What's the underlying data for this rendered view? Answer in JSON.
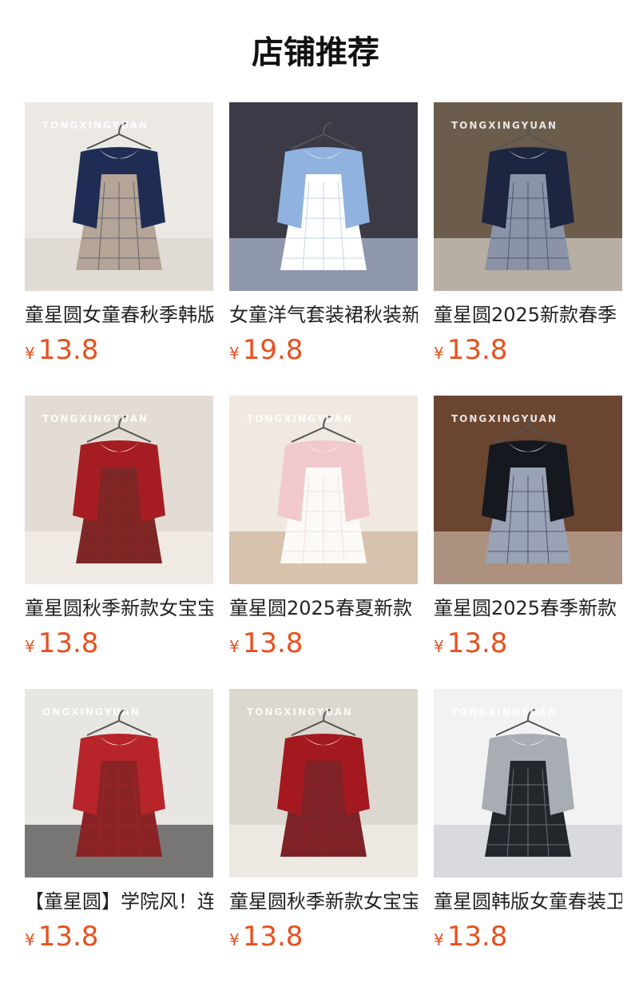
{
  "header": {
    "title": "店铺推荐"
  },
  "products": [
    {
      "name": "童星圆女童春秋季韩版",
      "currency": "¥",
      "price": "13.8",
      "watermark": "TONGXINGYUAN",
      "image": "girl-navy-cardigan-plaid-dress",
      "palette": [
        "#ece9e4",
        "#1f2d55",
        "#b5a596",
        "#d9d3cc"
      ]
    },
    {
      "name": "女童洋气套装裙秋装新款",
      "currency": "¥",
      "price": "19.8",
      "watermark": "",
      "image": "girl-blue-cardigan-floral-dress",
      "palette": [
        "#3b3a46",
        "#8fb3de",
        "#ffffff",
        "#c6d6ee"
      ]
    },
    {
      "name": "童星圆2025新款春季",
      "currency": "¥",
      "price": "13.8",
      "watermark": "TONGXINGYUAN",
      "image": "navy-cardigan-plaid-dress-flatlay",
      "palette": [
        "#6b5c4c",
        "#1d2541",
        "#8a93a7",
        "#e9e6e0"
      ]
    },
    {
      "name": "童星圆秋季新款女宝宝",
      "currency": "¥",
      "price": "13.8",
      "watermark": "TONGXINGYUAN",
      "image": "red-cardigan-plaid-dress",
      "palette": [
        "#e3dcd5",
        "#a51d22",
        "#7e2626",
        "#f7f3ee"
      ]
    },
    {
      "name": "童星圆2025春夏新款",
      "currency": "¥",
      "price": "13.8",
      "watermark": "TONGXINGYUAN",
      "image": "pink-tulle-dress-white-cardigan",
      "palette": [
        "#efe9e2",
        "#f1c9cd",
        "#fbfaf6",
        "#c7a98c"
      ]
    },
    {
      "name": "童星圆2025春季新款",
      "currency": "¥",
      "price": "13.8",
      "watermark": "TONGXINGYUAN",
      "image": "black-cardigan-plaid-dress-shelf",
      "palette": [
        "#6a4530",
        "#15181f",
        "#9aa2b5",
        "#d8c7b3"
      ]
    },
    {
      "name": "【童星圆】学院风！连",
      "currency": "¥",
      "price": "13.8",
      "watermark": "ONGXINGYUAN",
      "image": "girl-red-cardigan-plaid-skirt",
      "palette": [
        "#e8e6e3",
        "#b7242a",
        "#8a2326",
        "#2c2c2c"
      ]
    },
    {
      "name": "童星圆秋季新款女宝宝",
      "currency": "¥",
      "price": "13.8",
      "watermark": "TONGXINGYUAN",
      "image": "red-cardigan-plaid-dress-table",
      "palette": [
        "#dcd7cf",
        "#a3191f",
        "#7d2327",
        "#f6f3ee"
      ]
    },
    {
      "name": "童星圆韩版女童春装卫",
      "currency": "¥",
      "price": "13.8",
      "watermark": "TONGXINGYUAN",
      "image": "grey-bow-sweatshirt-skirt",
      "palette": [
        "#f2f2f2",
        "#a8adb4",
        "#23262b",
        "#c6c9ce"
      ]
    }
  ]
}
